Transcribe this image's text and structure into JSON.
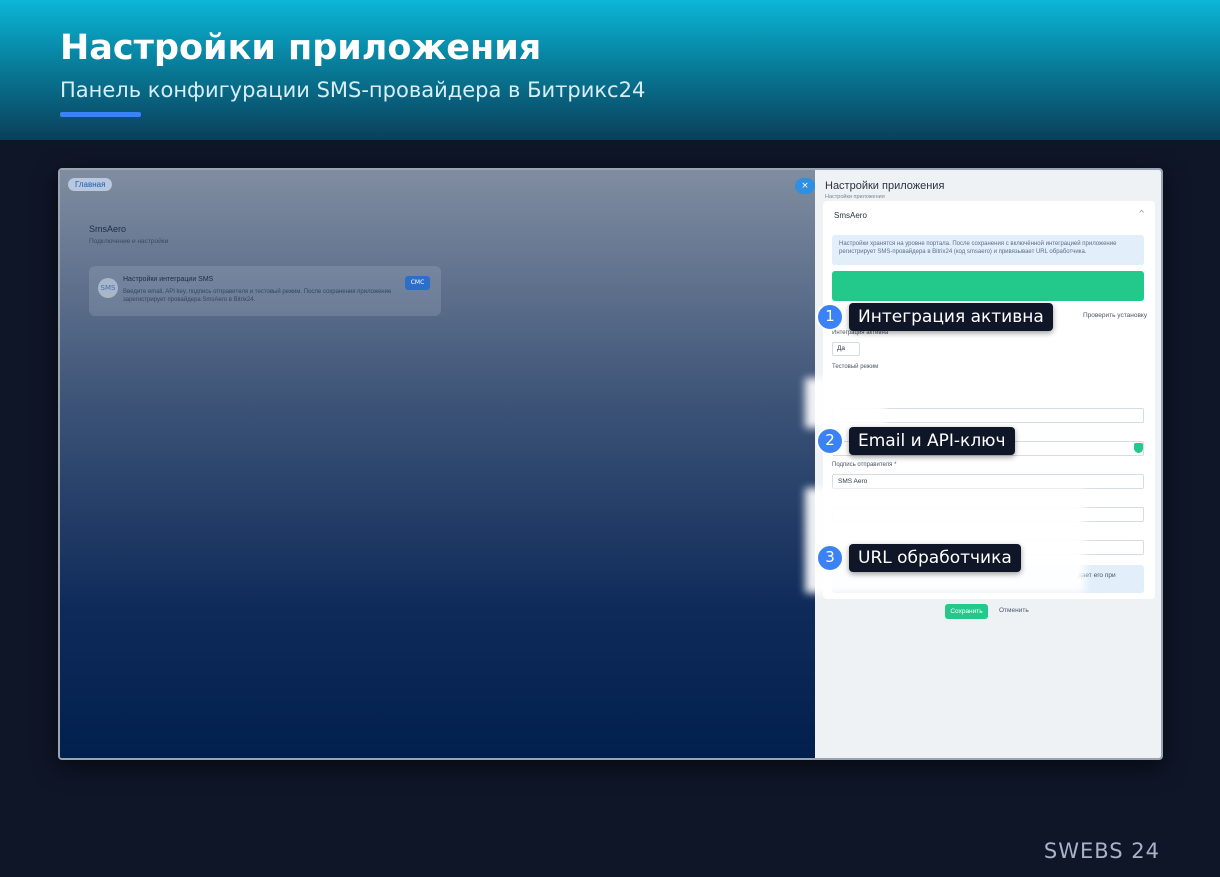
{
  "banner": {
    "title": "Настройки приложения",
    "subtitle": "Панель конфигурации SMS-провайдера в Битрикс24"
  },
  "screenshot": {
    "left": {
      "breadcrumb": "Главная",
      "close_icon": "×",
      "app_title": "SmsAero",
      "app_subtitle": "Подключение и настройки",
      "card": {
        "logo": "SMS",
        "title": "Настройки интеграции SMS",
        "description": "Введите email, API key, подпись отправителя и тестовый режим. После сохранения приложение зарегистрирует провайдера SmsAero в Bitrix24.",
        "button": "СМС"
      }
    },
    "right": {
      "title": "Настройки приложения",
      "breadcrumb": "Настройки приложения",
      "section": "SmsAero",
      "info": "Настройки хранятся на уровне портала. После сохранения с включённой интеграцией приложение регистрирует SMS-провайдера в Bitrix24 (код smsaero) и привязывает URL обработчика.",
      "check_install": "Проверить установку",
      "integration_label": "Интеграция активна",
      "integration_value": "Да",
      "test_mode_label": "Тестовый режим",
      "sender_label": "Подпись отправителя *",
      "sender_value": "SMS Aero",
      "handler_tail": "дает его при",
      "save": "Сохранить",
      "cancel": "Отменить"
    }
  },
  "callouts": [
    {
      "num": "1",
      "label": "Интеграция активна"
    },
    {
      "num": "2",
      "label": "Email и API-ключ"
    },
    {
      "num": "3",
      "label": "URL обработчика"
    }
  ],
  "brand": "SWEBS 24",
  "colors": {
    "accent": "#3b82f6",
    "success": "#22c98a",
    "background": "#0f1628"
  }
}
